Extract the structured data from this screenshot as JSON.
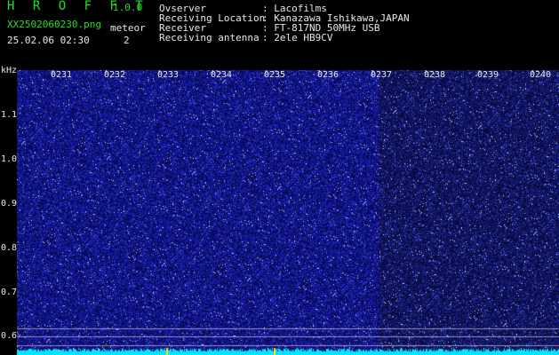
{
  "header": {
    "title": "H R O F F T",
    "version": "1.0.0",
    "filename": "XX2502060230.png",
    "datetime": "25.02.06 02:30",
    "meteor_label": "meteor",
    "meteor_count": "2"
  },
  "info": [
    {
      "label": "Ovserver",
      "value": ": Lacofilms"
    },
    {
      "label": "Receiving Location",
      "value": ": Kanazawa Ishikawa,JAPAN"
    },
    {
      "label": "Receiver",
      "value": ": FT-817ND 50MHz USB"
    },
    {
      "label": "Receiving antenna",
      "value": ": 2ele HB9CV"
    }
  ],
  "axis": {
    "unit": "kHz",
    "time_ticks": [
      "0231",
      "0232",
      "0233",
      "0234",
      "0235",
      "0236",
      "0237",
      "0238",
      "0239",
      "0240"
    ],
    "freq_ticks": [
      "1.1",
      "1.0",
      "0.9",
      "0.8",
      "0.7",
      "0.6"
    ]
  },
  "colors": {
    "label_green": "#21e021",
    "noise_blue": "#1b1fa8",
    "noise_dark": "#0b0d5a",
    "baseline_cyan": "#00e5ff"
  }
}
